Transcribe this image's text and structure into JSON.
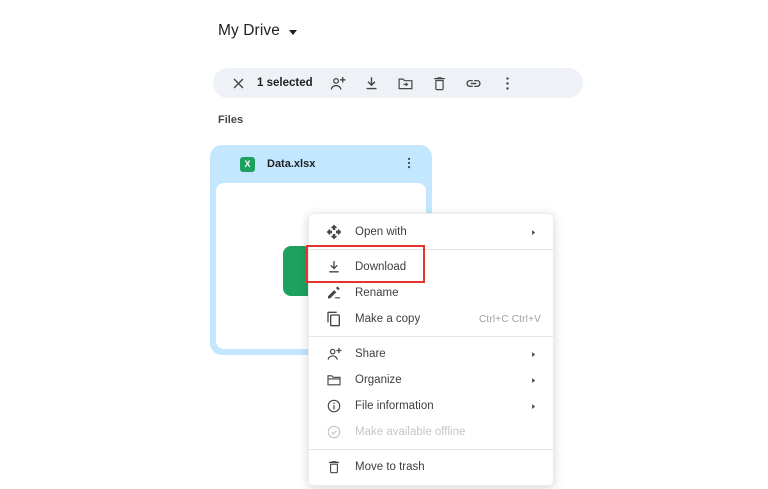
{
  "header": {
    "title": "My Drive"
  },
  "toolbar": {
    "selection_label": "1 selected",
    "icons": [
      "close-icon",
      "person-add-icon",
      "download-icon",
      "move-folder-icon",
      "trash-icon",
      "link-icon",
      "more-options-icon"
    ]
  },
  "files": {
    "section_label": "Files"
  },
  "file_card": {
    "name": "Data.xlsx",
    "badge_letter": "X",
    "selected": true
  },
  "context_menu": {
    "items": [
      {
        "label": "Open with",
        "icon": "open-with-icon",
        "has_submenu": true
      },
      {
        "label": "Download",
        "icon": "download-icon",
        "highlighted": true
      },
      {
        "label": "Rename",
        "icon": "rename-icon"
      },
      {
        "label": "Make a copy",
        "icon": "copy-icon",
        "shortcut": "Ctrl+C Ctrl+V"
      },
      {
        "label": "Share",
        "icon": "person-add-icon",
        "has_submenu": true
      },
      {
        "label": "Organize",
        "icon": "folder-icon",
        "has_submenu": true
      },
      {
        "label": "File information",
        "icon": "info-icon",
        "has_submenu": true
      },
      {
        "label": "Make available offline",
        "icon": "offline-check-icon",
        "disabled": true
      },
      {
        "label": "Move to trash",
        "icon": "trash-icon"
      }
    ]
  },
  "annotation": {
    "target": "Download",
    "color": "#e5342b"
  },
  "colors": {
    "selection_blue": "#c2e7ff",
    "toolbar_gray": "#eef1f6",
    "excel_green": "#1ea15f",
    "icon_gray": "#444746",
    "menu_text": "#3c4043",
    "disabled_text": "#c3c6c9",
    "shortcut_text": "#9aa0a6",
    "annotation_red": "#e5342b"
  }
}
